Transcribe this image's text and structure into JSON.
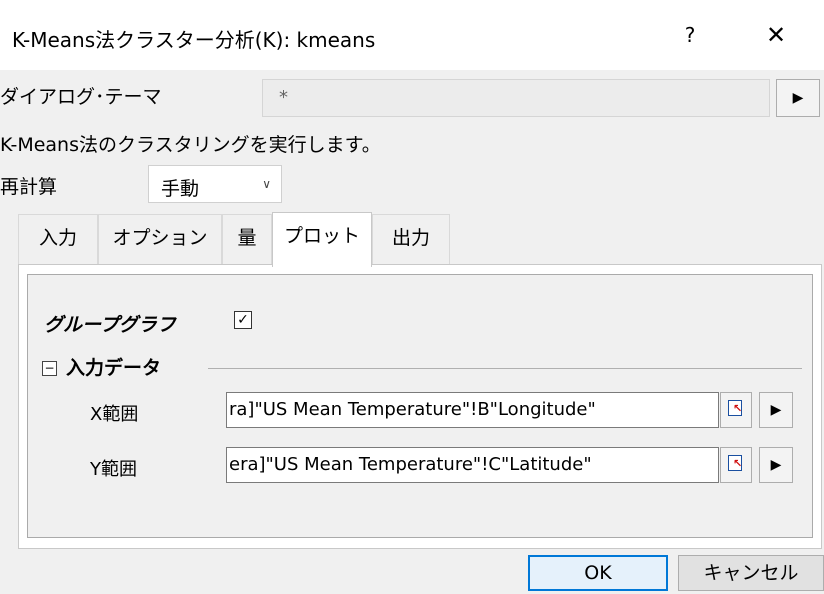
{
  "window": {
    "title": "K-Means法クラスター分析(K): kmeans",
    "help_label": "?",
    "close_label": "✕"
  },
  "theme": {
    "label": "ダイアログ･テーマ",
    "value": "*",
    "arrow": "▶"
  },
  "description": "K-Means法のクラスタリングを実行します。",
  "recalc": {
    "label": "再計算",
    "value": "手動",
    "chevron": "∨"
  },
  "tabs": [
    {
      "label": "入力"
    },
    {
      "label": "オプション"
    },
    {
      "label": "量"
    },
    {
      "label": "プロット",
      "active": true
    },
    {
      "label": "出力"
    }
  ],
  "plot": {
    "group_graph_label": "グループグラフ",
    "group_graph_checked": true,
    "check_mark": "✓",
    "collapse_symbol": "−",
    "input_data_label": "入力データ",
    "x_range_label": "X範囲",
    "x_range_value": "ra]\"US Mean Temperature\"!B\"Longitude\"",
    "y_range_label": "Y範囲",
    "y_range_value": "era]\"US Mean Temperature\"!C\"Latitude\"",
    "arrow": "▶"
  },
  "buttons": {
    "ok": "OK",
    "cancel": "キャンセル"
  }
}
